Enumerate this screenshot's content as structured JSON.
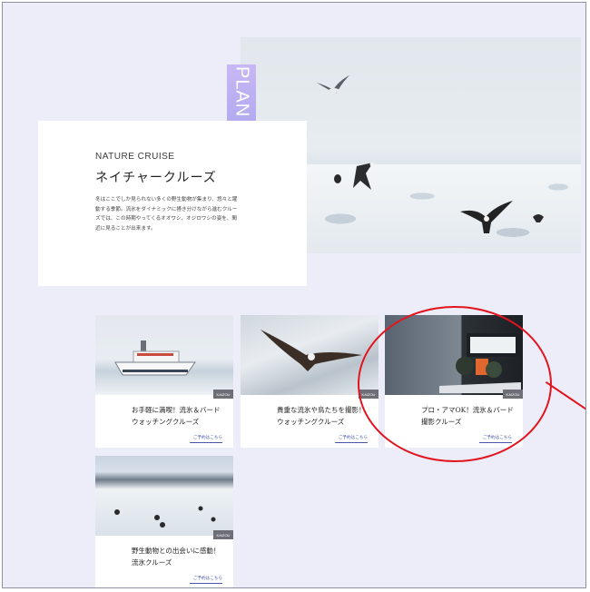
{
  "plan_label": "PLAN 01",
  "intro": {
    "title_en": "NATURE CRUISE",
    "title_ja": "ネイチャークルーズ",
    "body": "冬はここでしか見られない多くの野生動物が集まり、悠々と躍動する季節。流氷をダイナミックに掻き分けながら進むクルーズでは、この時期やってくるオオワシ、オジロワシの姿を、間近に見ることが出来ます。"
  },
  "cards": [
    {
      "tag": "KAIZOU",
      "title": "お手軽に満喫！流氷＆バードウォッチングクルーズ",
      "link": "ご予約はこちら"
    },
    {
      "tag": "KAIZOU",
      "title": "貴重な流氷や鳥たちを撮影！ウォッチングクルーズ",
      "link": "ご予約はこちら"
    },
    {
      "tag": "KAIZOU",
      "title": "プロ・アマOK！流氷＆バード撮影クルーズ",
      "link": "ご予約はこちら"
    },
    {
      "tag": "KAIZOU",
      "title": "野生動物との出会いに感動！流氷クルーズ",
      "link": "ご予約はこちら"
    }
  ],
  "colors": {
    "background": "#ecedf8",
    "accent_link": "#4a5aa8",
    "plan_label": "#b9adf1",
    "annotation": "#e2151f"
  }
}
